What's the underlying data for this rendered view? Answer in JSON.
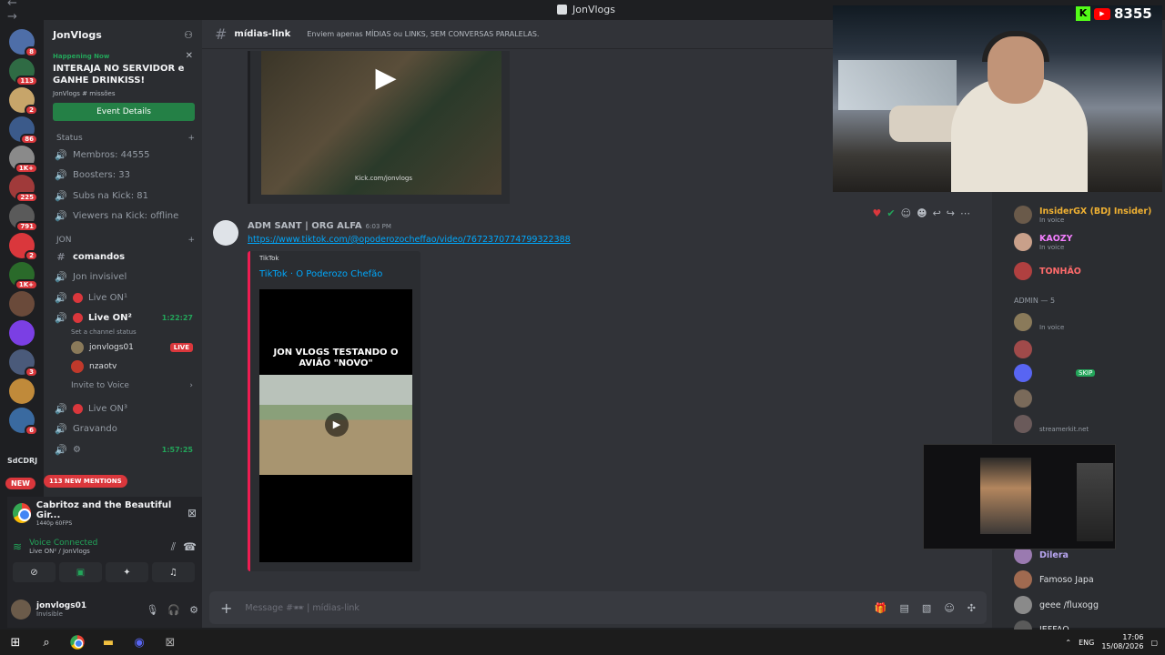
{
  "window": {
    "title": "JonVlogs"
  },
  "viewer_overlay": {
    "count": "8355"
  },
  "servers": {
    "new_label": "NEW",
    "text_server": "SdCDRJ",
    "items": [
      {
        "badge": "8",
        "color": "#4e6ea8"
      },
      {
        "badge": "113",
        "color": "#2f6b44"
      },
      {
        "badge": "2",
        "color": "#c7a56a"
      },
      {
        "badge": "86",
        "color": "#3b5a8a"
      },
      {
        "badge": "1K+",
        "color": "#8a8a8a"
      },
      {
        "badge": "225",
        "color": "#a03a3a"
      },
      {
        "badge": "791",
        "color": "#5a5a5a"
      },
      {
        "badge": "2",
        "color": "#da373c"
      },
      {
        "badge": "1K+",
        "color": "#2a6a2a"
      },
      {
        "badge": "",
        "color": "#6a4a3a"
      },
      {
        "badge": "",
        "color": "#7b3fe4"
      },
      {
        "badge": "3",
        "color": "#4a5a7a"
      },
      {
        "badge": "",
        "color": "#c08a3a"
      },
      {
        "badge": "6",
        "color": "#3a6aa0"
      }
    ]
  },
  "guild": {
    "name": "JonVlogs",
    "event": {
      "status": "Happening Now",
      "title": "INTERAJA NO SERVIDOR e GANHE DRINKISS!",
      "location": "JonVlogs  #  missões",
      "button": "Event Details"
    },
    "categories": {
      "status": "Status",
      "jon": "JON"
    },
    "status_channels": [
      {
        "label": "Membros: 44555",
        "icon": "🔊"
      },
      {
        "label": "Boosters: 33",
        "icon": "🔊"
      },
      {
        "label": "Subs na Kick: 81",
        "icon": "🔊"
      },
      {
        "label": "Viewers na Kick: offline",
        "icon": "🔊"
      }
    ],
    "jon_channels": {
      "comandos": "comandos",
      "jon_invisivel": "Jon invisivel",
      "live_on_1": "Live ON¹",
      "live_on_2": "Live ON²",
      "live_on_2_time": "1:22:27",
      "set_status": "Set a channel status",
      "voice_users": [
        {
          "name": "jonvlogs01",
          "live": "LIVE"
        },
        {
          "name": "nzaotv",
          "live": ""
        }
      ],
      "invite": "Invite to Voice",
      "live_on_3": "Live ON³",
      "gravando": "Gravando",
      "last_time": "1:57:25"
    },
    "mentions_pill": "113 NEW MENTIONS"
  },
  "activity": {
    "title": "Cabritoz and the Beautiful Gir...",
    "sub": "1440p 60FPS"
  },
  "voice": {
    "status": "Voice Connected",
    "location": "Live ON² / JonVlogs"
  },
  "user": {
    "name": "jonvlogs01",
    "status": "Invisible"
  },
  "channel": {
    "name": "mídias-link",
    "topic": "Enviem apenas MÍDIAS ou LINKS, SEM CONVERSAS PARALELAS."
  },
  "messages": {
    "prev_watermark": "Kick.com/jonvlogs",
    "author": "ADM SANT | ORG ALFA",
    "time": "6:03 PM",
    "link": "https://www.tiktok.com/@opoderozocheffao/video/7672370774799322388",
    "embed": {
      "provider": "TikTok",
      "title": "TikTok · O Poderozo Chefão",
      "video_text": "JON VLOGS TESTANDO O AVIÃO \"NOVO\""
    }
  },
  "composer": {
    "placeholder": "Message #🕶 | mídias-link"
  },
  "members": {
    "role_header": "ADMIN — 5",
    "items": [
      {
        "name": "InsiderGX (BDJ Insider)",
        "sub": "In voice",
        "color": "#f0b132"
      },
      {
        "name": "KAOZY",
        "sub": "In voice",
        "color": "#f47fff"
      },
      {
        "name": "TONHÃO",
        "sub": "",
        "color": "#ff6b6b"
      },
      {
        "name": "Dilera",
        "sub": "",
        "color": "#b9a6f2"
      },
      {
        "name": "Famoso Japa",
        "sub": "",
        "color": "#dbdee1"
      },
      {
        "name": "geee /fluxogg",
        "sub": "",
        "color": "#dbdee1"
      },
      {
        "name": "JEFFAO",
        "sub": "",
        "color": "#dbdee1"
      }
    ],
    "admin_sub": "streamerkit.net",
    "skip_label": "SKIP"
  },
  "taskbar": {
    "lang": "ENG",
    "time": "17:06",
    "date": "15/08/2026"
  }
}
